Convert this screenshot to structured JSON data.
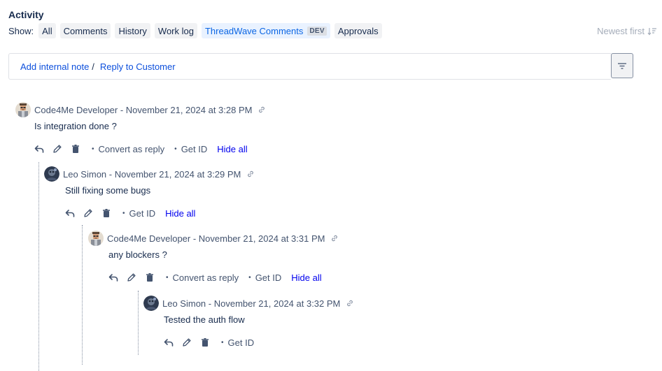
{
  "activity": {
    "title": "Activity"
  },
  "show": {
    "label": "Show:",
    "filters": [
      {
        "label": "All"
      },
      {
        "label": "Comments"
      },
      {
        "label": "History"
      },
      {
        "label": "Work log"
      },
      {
        "label": "ThreadWave Comments",
        "badge": "DEV",
        "active": true
      },
      {
        "label": "Approvals"
      }
    ],
    "sort_label": "Newest first"
  },
  "reply": {
    "internal_note": "Add internal note",
    "separator": "/",
    "reply_customer": "Reply to Customer"
  },
  "comments": [
    {
      "author": "Code4Me Developer",
      "date": "November 21, 2024 at 3:28 PM",
      "body": "Is integration done ?",
      "avatar": "developer-avatar",
      "convert": "Convert as reply",
      "get_id": "Get ID",
      "hide_all": "Hide all"
    },
    {
      "author": "Leo Simon",
      "date": "November 21, 2024 at 3:29 PM",
      "body": "Still fixing some bugs",
      "avatar": "leo-avatar",
      "get_id": "Get ID",
      "hide_all": "Hide all"
    },
    {
      "author": "Code4Me Developer",
      "date": "November 21, 2024 at 3:31 PM",
      "body": "any blockers ?",
      "avatar": "developer-avatar",
      "convert": "Convert as reply",
      "get_id": "Get ID",
      "hide_all": "Hide all"
    },
    {
      "author": "Leo Simon",
      "date": "November 21, 2024 at 3:32 PM",
      "body": "Tested the auth flow",
      "avatar": "leo-avatar",
      "get_id": "Get ID"
    }
  ],
  "colors": {
    "link": "#0c4fdc",
    "hide_all": "#0000ee",
    "active_filter": "#0c66e4",
    "muted": "#44546f"
  }
}
